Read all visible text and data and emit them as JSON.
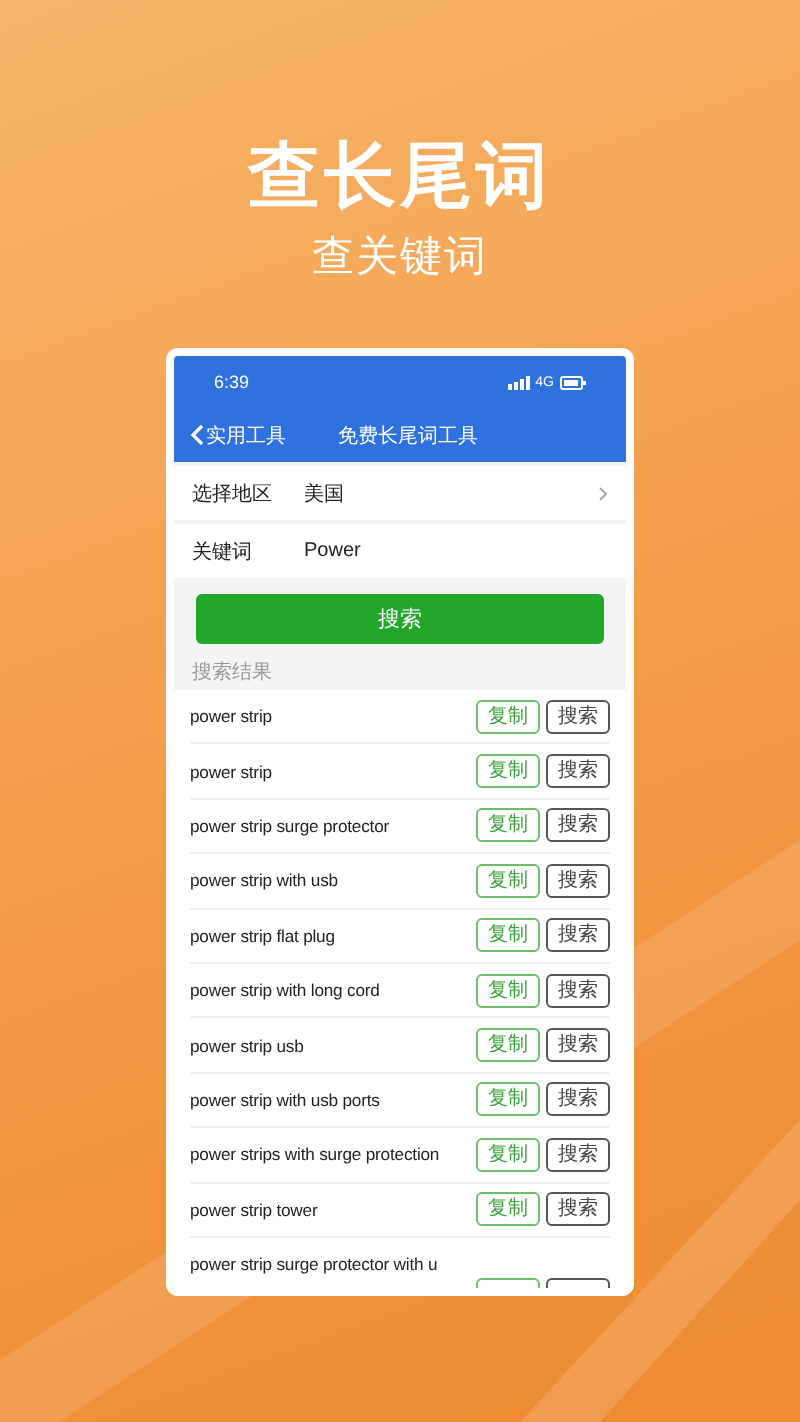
{
  "headline": "查长尾词",
  "subheadline": "查关键词",
  "status_bar": {
    "time": "6:39",
    "network": "4G"
  },
  "nav": {
    "back_label": "实用工具",
    "title": "免费长尾词工具"
  },
  "form": [
    {
      "kind": "select",
      "label": "选择地区",
      "value": "美国"
    },
    {
      "kind": "text",
      "label": "关键词",
      "value": "Power"
    }
  ],
  "search_button": "搜索",
  "results_label": "搜索结果",
  "results": [
    {
      "text": "power strip",
      "copy": "复制",
      "search": "搜索"
    },
    {
      "text": "power strip",
      "copy": "复制",
      "search": "搜索"
    },
    {
      "text": "power strip surge protector",
      "copy": "复制",
      "search": "搜索"
    },
    {
      "text": "power strip with usb",
      "copy": "复制",
      "search": "搜索"
    },
    {
      "text": "power strip flat plug",
      "copy": "复制",
      "search": "搜索"
    },
    {
      "text": "power strip with long cord",
      "copy": "复制",
      "search": "搜索"
    },
    {
      "text": "power strip usb",
      "copy": "复制",
      "search": "搜索"
    },
    {
      "text": "power strip with usb ports",
      "copy": "复制",
      "search": "搜索"
    },
    {
      "text": "power strips with surge protection",
      "copy": "复制",
      "search": "搜索"
    },
    {
      "text": "power strip tower",
      "copy": "复制",
      "search": "搜索"
    },
    {
      "text": "power strip surge protector with u"
    }
  ]
}
